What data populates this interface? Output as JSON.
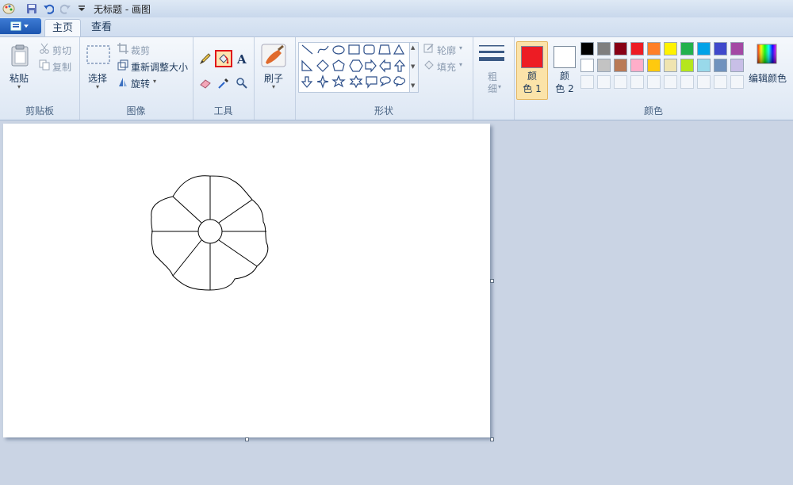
{
  "titlebar": {
    "title": "无标题 - 画图"
  },
  "tabs": {
    "home": "主页",
    "view": "查看"
  },
  "clipboard": {
    "paste": "粘贴",
    "cut": "剪切",
    "copy": "复制",
    "group": "剪贴板"
  },
  "image": {
    "select": "选择",
    "crop": "裁剪",
    "resize": "重新调整大小",
    "rotate": "旋转",
    "group": "图像"
  },
  "tools": {
    "group": "工具",
    "selected_tool": "fill-bucket"
  },
  "brushes": {
    "label": "刷子"
  },
  "shapes": {
    "outline": "轮廓",
    "fill": "填充",
    "group": "形状"
  },
  "size": {
    "label_line1": "粗",
    "label_line2": "细"
  },
  "colors": {
    "color1_line1": "颜",
    "color1_line2": "色 1",
    "color2_line1": "颜",
    "color2_line2": "色 2",
    "color1_value": "#ed1c24",
    "color2_value": "#ffffff",
    "edit_label": "编辑颜色",
    "group": "颜色",
    "palette_row1": [
      "#000000",
      "#7f7f7f",
      "#880015",
      "#ed1c24",
      "#ff7f27",
      "#fff200",
      "#22b14c",
      "#00a2e8",
      "#3f48cc",
      "#a349a4"
    ],
    "palette_row2": [
      "#ffffff",
      "#c3c3c3",
      "#b97a57",
      "#ffaec9",
      "#ffc90e",
      "#efe4b0",
      "#b5e61d",
      "#99d9ea",
      "#7092be",
      "#c8bfe7"
    ]
  }
}
